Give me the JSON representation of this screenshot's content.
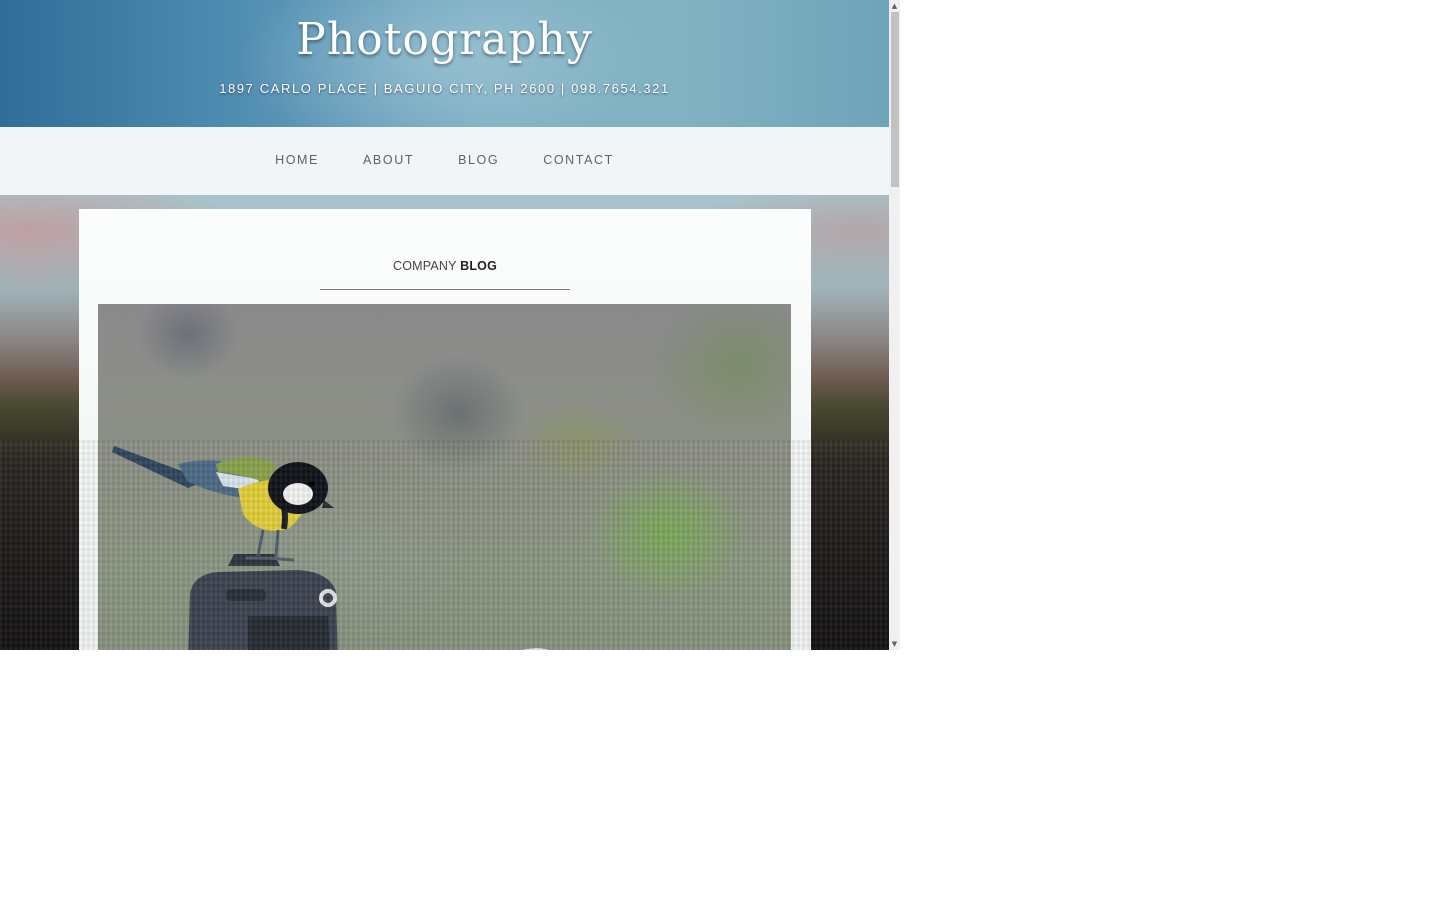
{
  "header": {
    "title": "Photography",
    "address": "1897 CARLO PLACE | BAGUIO CITY, PH 2600 | 098.7654.321"
  },
  "nav": {
    "items": [
      "HOME",
      "ABOUT",
      "BLOG",
      "CONTACT"
    ]
  },
  "main": {
    "heading_light": "COMPANY",
    "heading_bold": "BLOG",
    "image_icon": "bird-on-camera-photo"
  },
  "scrollbar": {
    "up_icon": "scroll-up-arrow-icon",
    "down_icon": "scroll-down-arrow-icon",
    "scroll_fraction": 0
  }
}
